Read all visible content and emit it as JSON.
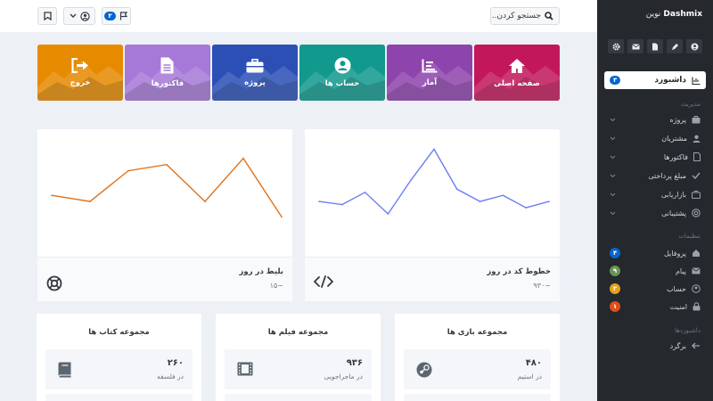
{
  "header": {
    "search_placeholder": "جستجو کردن..",
    "notifications_badge": "۳"
  },
  "sidebar": {
    "brand": "Dashmix",
    "brand_sub": "نوین",
    "active_item": {
      "label": "داشبورد",
      "badge": "۳"
    },
    "section_management": "مدیریت",
    "management_items": [
      "پروژه",
      "مشتریان",
      "فاکتورها",
      "مبلغ پرداختی",
      "بازاریابی",
      "پشتیبانی"
    ],
    "section_settings": "تنظیمات",
    "settings_items": [
      {
        "label": "پروفایل",
        "badge": "۴",
        "color": "#0665d0"
      },
      {
        "label": "پیام",
        "badge": "۹",
        "color": "#689550"
      },
      {
        "label": "حساب",
        "badge": "۳",
        "color": "#e4a11b"
      },
      {
        "label": "امنیت",
        "badge": "۱",
        "color": "#e04f1a"
      }
    ],
    "section_dashboards": "داشبوردها",
    "dashboard_items": [
      "برگرد"
    ]
  },
  "tiles": [
    {
      "label": "صفحه اصلی",
      "icon": "home-icon",
      "color": "#c2185b"
    },
    {
      "label": "آمار",
      "icon": "chart-icon",
      "color": "#8e44ad"
    },
    {
      "label": "حساب ها",
      "icon": "user-icon",
      "color": "#11998e"
    },
    {
      "label": "پروژه",
      "icon": "briefcase-icon",
      "color": "#2b4fb5"
    },
    {
      "label": "فاکتورها",
      "icon": "file-icon",
      "color": "#a678d8"
    },
    {
      "label": "خروج",
      "icon": "logout-icon",
      "color": "#e68a00"
    }
  ],
  "chart_cards": [
    {
      "label": "خطوط کد در روز",
      "value": "~۹۳۰",
      "icon": "code-icon",
      "chart_data": {
        "type": "line",
        "x": [
          1,
          2,
          3,
          4,
          5,
          6,
          7,
          8,
          9,
          10,
          11
        ],
        "y": [
          30,
          28,
          36,
          22,
          44,
          64,
          38,
          30,
          34,
          26,
          30
        ],
        "color": "#6c7ff2",
        "ylim": [
          0,
          70
        ]
      }
    },
    {
      "label": "بلیط در روز",
      "value": "~۱۵",
      "icon": "lifebuoy-icon",
      "chart_data": {
        "type": "line",
        "x": [
          1,
          2,
          3,
          4,
          5,
          6,
          7
        ],
        "y": [
          34,
          30,
          50,
          54,
          30,
          58,
          20
        ],
        "color": "#e0721a",
        "ylim": [
          0,
          70
        ]
      }
    }
  ],
  "collections": [
    {
      "title": "مجموعه بازی ها",
      "num": "۴۸۰",
      "label": "در استیم",
      "icon": "steam-icon"
    },
    {
      "title": "مجموعه فیلم ها",
      "num": "۹۳۶",
      "label": "در ماجراجویی",
      "icon": "film-icon"
    },
    {
      "title": "مجموعه کتاب ها",
      "num": "۲۶۰",
      "label": "در فلسفه",
      "icon": "book-icon"
    }
  ]
}
